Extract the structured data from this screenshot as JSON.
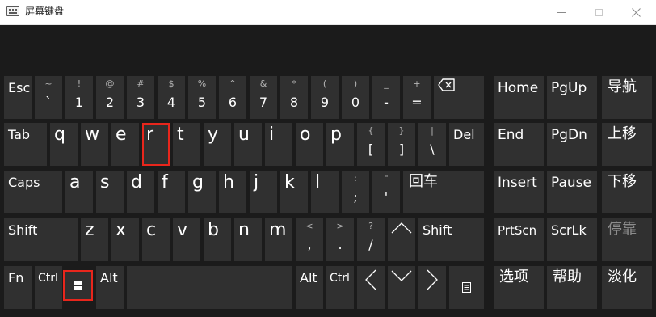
{
  "window": {
    "title": "屏幕键盘"
  },
  "rows": {
    "r1": [
      {
        "main": "Esc"
      },
      {
        "shift": "~",
        "base": "`"
      },
      {
        "shift": "!",
        "base": "1"
      },
      {
        "shift": "@",
        "base": "2"
      },
      {
        "shift": "#",
        "base": "3"
      },
      {
        "shift": "$",
        "base": "4"
      },
      {
        "shift": "%",
        "base": "5"
      },
      {
        "shift": "^",
        "base": "6"
      },
      {
        "shift": "&",
        "base": "7"
      },
      {
        "shift": "*",
        "base": "8"
      },
      {
        "shift": "(",
        "base": "9"
      },
      {
        "shift": ")",
        "base": "0"
      },
      {
        "shift": "_",
        "base": "-"
      },
      {
        "shift": "+",
        "base": "="
      }
    ],
    "r2": [
      {
        "main": "Tab"
      },
      {
        "main": "q"
      },
      {
        "main": "w"
      },
      {
        "main": "e"
      },
      {
        "main": "r"
      },
      {
        "main": "t"
      },
      {
        "main": "y"
      },
      {
        "main": "u"
      },
      {
        "main": "i"
      },
      {
        "main": "o"
      },
      {
        "main": "p"
      },
      {
        "shift": "{",
        "base": "["
      },
      {
        "shift": "}",
        "base": "]"
      },
      {
        "shift": "|",
        "base": "\\"
      },
      {
        "main": "Del"
      }
    ],
    "r3": [
      {
        "main": "Caps"
      },
      {
        "main": "a"
      },
      {
        "main": "s"
      },
      {
        "main": "d"
      },
      {
        "main": "f"
      },
      {
        "main": "g"
      },
      {
        "main": "h"
      },
      {
        "main": "j"
      },
      {
        "main": "k"
      },
      {
        "main": "l"
      },
      {
        "shift": ":",
        "base": ";"
      },
      {
        "shift": "\"",
        "base": "'"
      },
      {
        "main": "回车"
      }
    ],
    "r4": [
      {
        "main": "Shift"
      },
      {
        "main": "z"
      },
      {
        "main": "x"
      },
      {
        "main": "c"
      },
      {
        "main": "v"
      },
      {
        "main": "b"
      },
      {
        "main": "n"
      },
      {
        "main": "m"
      },
      {
        "shift": "<",
        "base": ","
      },
      {
        "shift": ">",
        "base": "."
      },
      {
        "shift": "?",
        "base": "/"
      },
      {
        "main": "Shift"
      }
    ],
    "r5": [
      {
        "main": "Fn"
      },
      {
        "main": "Ctrl"
      },
      {
        "main": "Alt"
      },
      {
        "main": "Alt"
      },
      {
        "main": "Ctrl"
      }
    ],
    "nav": [
      {
        "main": "Home"
      },
      {
        "main": "PgUp"
      },
      {
        "main": "导航"
      },
      {
        "main": "End"
      },
      {
        "main": "PgDn"
      },
      {
        "main": "上移"
      },
      {
        "main": "Insert"
      },
      {
        "main": "Pause"
      },
      {
        "main": "下移"
      },
      {
        "main": "PrtScn"
      },
      {
        "main": "ScrLk"
      },
      {
        "main": "停靠"
      },
      {
        "main": "选项"
      },
      {
        "main": "帮助"
      },
      {
        "main": "淡化"
      }
    ]
  },
  "highlighted_keys": [
    "r",
    "Windows"
  ],
  "colors": {
    "key": "#303030",
    "background": "#1b1b1b",
    "highlight": "#e8261c",
    "disabled_text": "#8c8c8c"
  },
  "icons": [
    "backspace-icon",
    "up-arrow-icon",
    "left-arrow-icon",
    "down-arrow-icon",
    "right-arrow-icon",
    "windows-icon",
    "menu-icon"
  ]
}
